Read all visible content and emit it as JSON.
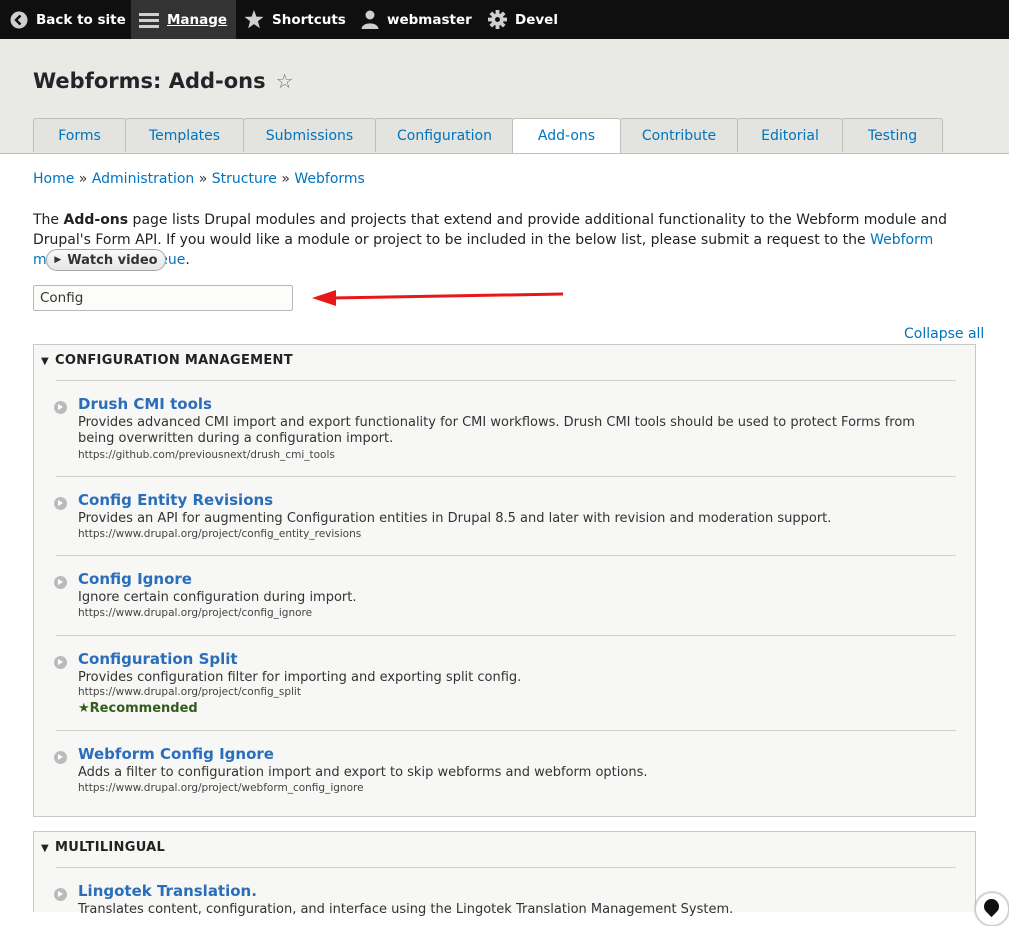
{
  "toolbar": {
    "back": "Back to site",
    "manage": "Manage",
    "shortcuts": "Shortcuts",
    "user": "webmaster",
    "devel": "Devel"
  },
  "page": {
    "title": "Webforms: Add-ons"
  },
  "tabs": [
    "Forms",
    "Templates",
    "Submissions",
    "Configuration",
    "Add-ons",
    "Contribute",
    "Editorial",
    "Testing"
  ],
  "active_tab": "Add-ons",
  "breadcrumb": [
    "Home",
    "Administration",
    "Structure",
    "Webforms"
  ],
  "breadcrumb_sep": "»",
  "intro": {
    "part1": "The ",
    "bold": "Add-ons",
    "part2": " page lists Drupal modules and projects that extend and provide additional functionality to the Webform module and Drupal's Form API. If you would like a module or project to be included in the below list, please submit a request to the ",
    "link": "Webform module's issue queue",
    "part3": "."
  },
  "watch_video": "Watch video",
  "search": {
    "value": "Config"
  },
  "collapse_all": "Collapse all",
  "sections": [
    {
      "title": "CONFIGURATION MANAGEMENT",
      "items": [
        {
          "title": "Drush CMI tools",
          "description": "Provides advanced CMI import and export functionality for CMI workflows. Drush CMI tools should be used to protect Forms from being overwritten during a configuration import.",
          "url": "https://github.com/previousnext/drush_cmi_tools"
        },
        {
          "title": "Config Entity Revisions",
          "description": "Provides an API for augmenting Configuration entities in Drupal 8.5 and later with revision and moderation support.",
          "url": "https://www.drupal.org/project/config_entity_revisions"
        },
        {
          "title": "Config Ignore",
          "description": "Ignore certain configuration during import.",
          "url": "https://www.drupal.org/project/config_ignore"
        },
        {
          "title": "Configuration Split",
          "description": "Provides configuration filter for importing and exporting split config.",
          "url": "https://www.drupal.org/project/config_split",
          "recommended": "★Recommended"
        },
        {
          "title": "Webform Config Ignore",
          "description": "Adds a filter to configuration import and export to skip webforms and webform options.",
          "url": "https://www.drupal.org/project/webform_config_ignore"
        }
      ]
    },
    {
      "title": "MULTILINGUAL",
      "items": [
        {
          "title": "Lingotek Translation.",
          "description": "Translates content, configuration, and interface using the Lingotek Translation Management System."
        }
      ]
    }
  ],
  "colors": {
    "link": "#0074bd",
    "toolbar_bg": "#0f0f0f",
    "header_bg": "#e9e9e5",
    "arrow": "#e8171a",
    "recommended": "#325e1c"
  }
}
